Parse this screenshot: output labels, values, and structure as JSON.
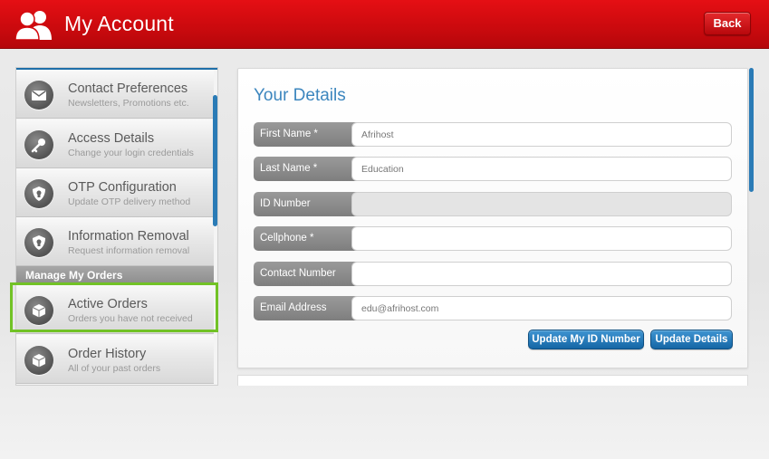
{
  "header": {
    "title": "My Account",
    "back_label": "Back",
    "brand_color": "#d30b10"
  },
  "sidebar": {
    "items": [
      {
        "label": "Contact Preferences",
        "sub": "Newsletters, Promotions etc.",
        "icon": "envelope-icon"
      },
      {
        "label": "Access Details",
        "sub": "Change your login credentials",
        "icon": "key-icon"
      },
      {
        "label": "OTP Configuration",
        "sub": "Update OTP delivery method",
        "icon": "shield-icon"
      },
      {
        "label": "Information Removal",
        "sub": "Request information removal",
        "icon": "shield-icon"
      }
    ],
    "section_label": "Manage My Orders",
    "orders": [
      {
        "label": "Active Orders",
        "sub": "Orders you have not received",
        "icon": "box-icon",
        "highlighted": true
      },
      {
        "label": "Order History",
        "sub": "All of your past orders",
        "icon": "box-icon"
      }
    ],
    "highlight_color": "#72c226"
  },
  "details": {
    "title": "Your Details",
    "fields": [
      {
        "label": "First Name *",
        "value": "Afrihost",
        "disabled": false
      },
      {
        "label": "Last Name *",
        "value": "Education",
        "disabled": false
      },
      {
        "label": "ID Number",
        "value": "",
        "disabled": true
      },
      {
        "label": "Cellphone *",
        "value": "",
        "disabled": false
      },
      {
        "label": "Contact Number",
        "value": "",
        "disabled": false
      },
      {
        "label": "Email Address",
        "value": "edu@afrihost.com",
        "disabled": false
      }
    ],
    "update_id_label": "Update My ID Number",
    "update_details_label": "Update Details",
    "accent_color": "#3c86be"
  }
}
